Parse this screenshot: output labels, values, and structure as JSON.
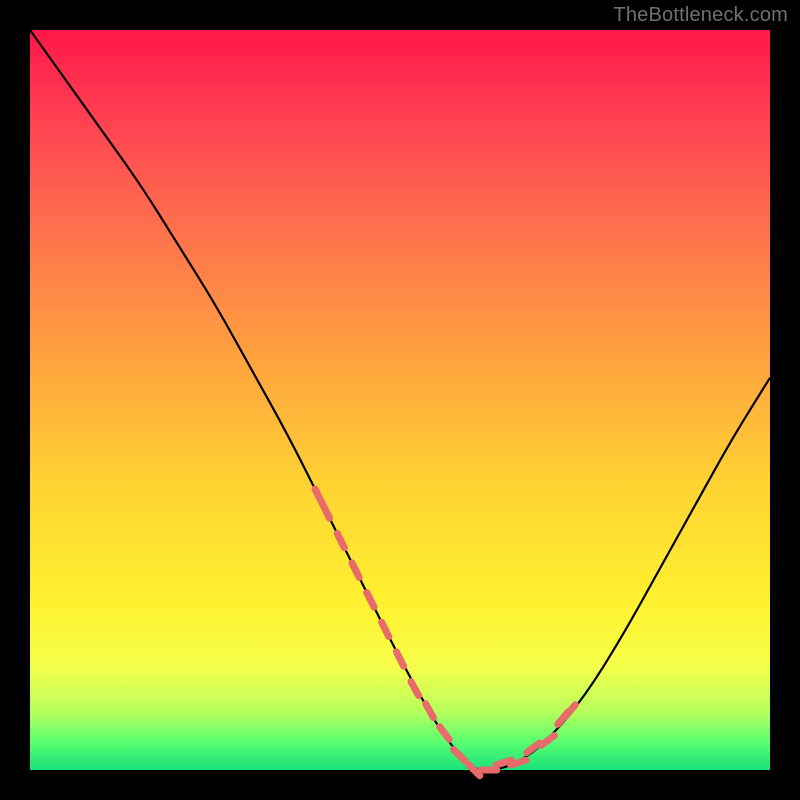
{
  "watermark": "TheBottleneck.com",
  "colors": {
    "bg": "#000000",
    "curve": "#000000",
    "marker": "#e86a6a",
    "gradient_top": "#ff1748",
    "gradient_bottom": "#17e27c"
  },
  "chart_data": {
    "type": "line",
    "title": "",
    "xlabel": "",
    "ylabel": "",
    "xlim": [
      0,
      100
    ],
    "ylim": [
      0,
      100
    ],
    "grid": false,
    "legend": false,
    "annotations": [
      "TheBottleneck.com"
    ],
    "series": [
      {
        "name": "bottleneck-curve",
        "x": [
          0,
          5,
          10,
          15,
          20,
          25,
          30,
          35,
          40,
          45,
          50,
          55,
          58,
          60,
          63,
          66,
          70,
          75,
          80,
          85,
          90,
          95,
          100
        ],
        "values": [
          100,
          93,
          86,
          79,
          71,
          63,
          54,
          45,
          35,
          25,
          15,
          6,
          2,
          0,
          0,
          1,
          4,
          10,
          18,
          27,
          36,
          45,
          53
        ]
      },
      {
        "name": "highlight-markers",
        "x": [
          39,
          40,
          42,
          44,
          46,
          48,
          50,
          52,
          54,
          56,
          58,
          60,
          62,
          64,
          66,
          68,
          70,
          72,
          73
        ],
        "values": [
          37,
          35,
          31,
          27,
          23,
          19,
          15,
          11,
          8,
          5,
          2,
          0,
          0,
          1,
          1,
          3,
          4,
          7,
          8
        ]
      }
    ]
  }
}
